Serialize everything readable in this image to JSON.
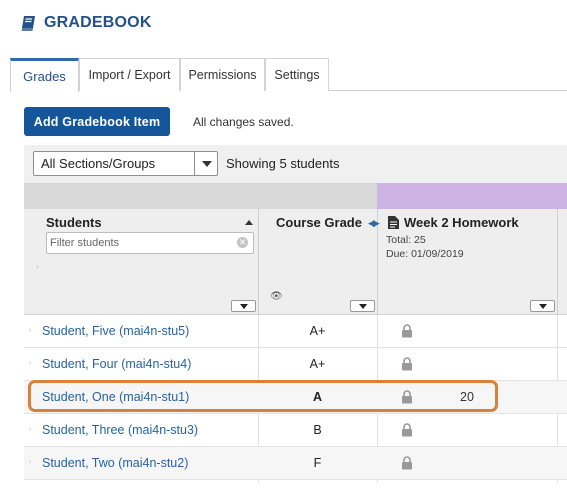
{
  "app": {
    "title": "GRADEBOOK",
    "icon": "book-icon"
  },
  "tabs": [
    {
      "label": "Grades",
      "active": true
    },
    {
      "label": "Import / Export",
      "active": false
    },
    {
      "label": "Permissions",
      "active": false
    },
    {
      "label": "Settings",
      "active": false
    }
  ],
  "toolbar": {
    "add_item_label": "Add Gradebook Item",
    "save_status": "All changes saved.",
    "section_select": "All Sections/Groups",
    "showing_text": "Showing 5 students"
  },
  "grid": {
    "students_header": "Students",
    "filter_placeholder": "Filter students",
    "course_grade_header": "Course Grade",
    "item": {
      "title": "Week 2 Homework",
      "total": "Total: 25",
      "due": "Due: 01/09/2019",
      "header_color": "#cdb3e3"
    },
    "rows": [
      {
        "name": "Student, Five (mai4n-stu5)",
        "grade": "A+",
        "score": ""
      },
      {
        "name": "Student, Four (mai4n-stu4)",
        "grade": "A+",
        "score": ""
      },
      {
        "name": "Student, One (mai4n-stu1)",
        "grade": "A",
        "score": "20",
        "highlighted": true
      },
      {
        "name": "Student, Three (mai4n-stu3)",
        "grade": "B",
        "score": ""
      },
      {
        "name": "Student, Two (mai4n-stu2)",
        "grade": "F",
        "score": ""
      }
    ]
  },
  "colors": {
    "brand": "#25508a",
    "button": "#15569a",
    "highlight": "#d9803a",
    "link": "#2763a4"
  }
}
